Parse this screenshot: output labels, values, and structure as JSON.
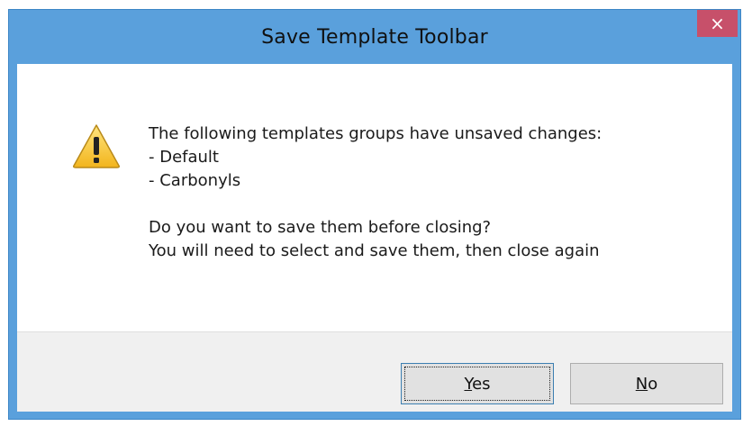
{
  "dialog": {
    "title": "Save Template Toolbar",
    "close_glyph": "×",
    "icon": "warning-icon",
    "message": {
      "line1": "The following templates groups have unsaved changes:",
      "line2": "- Default",
      "line3": "- Carbonyls",
      "line4": "Do you want to save them before closing?",
      "line5": "You will need to select and save them, then close again"
    },
    "buttons": {
      "yes_mnemonic": "Y",
      "yes_rest": "es",
      "no_mnemonic": "N",
      "no_rest": "o"
    },
    "colors": {
      "frame": "#5aa0dc",
      "close_button": "#c7506a",
      "footer": "#f0f0f0"
    }
  }
}
